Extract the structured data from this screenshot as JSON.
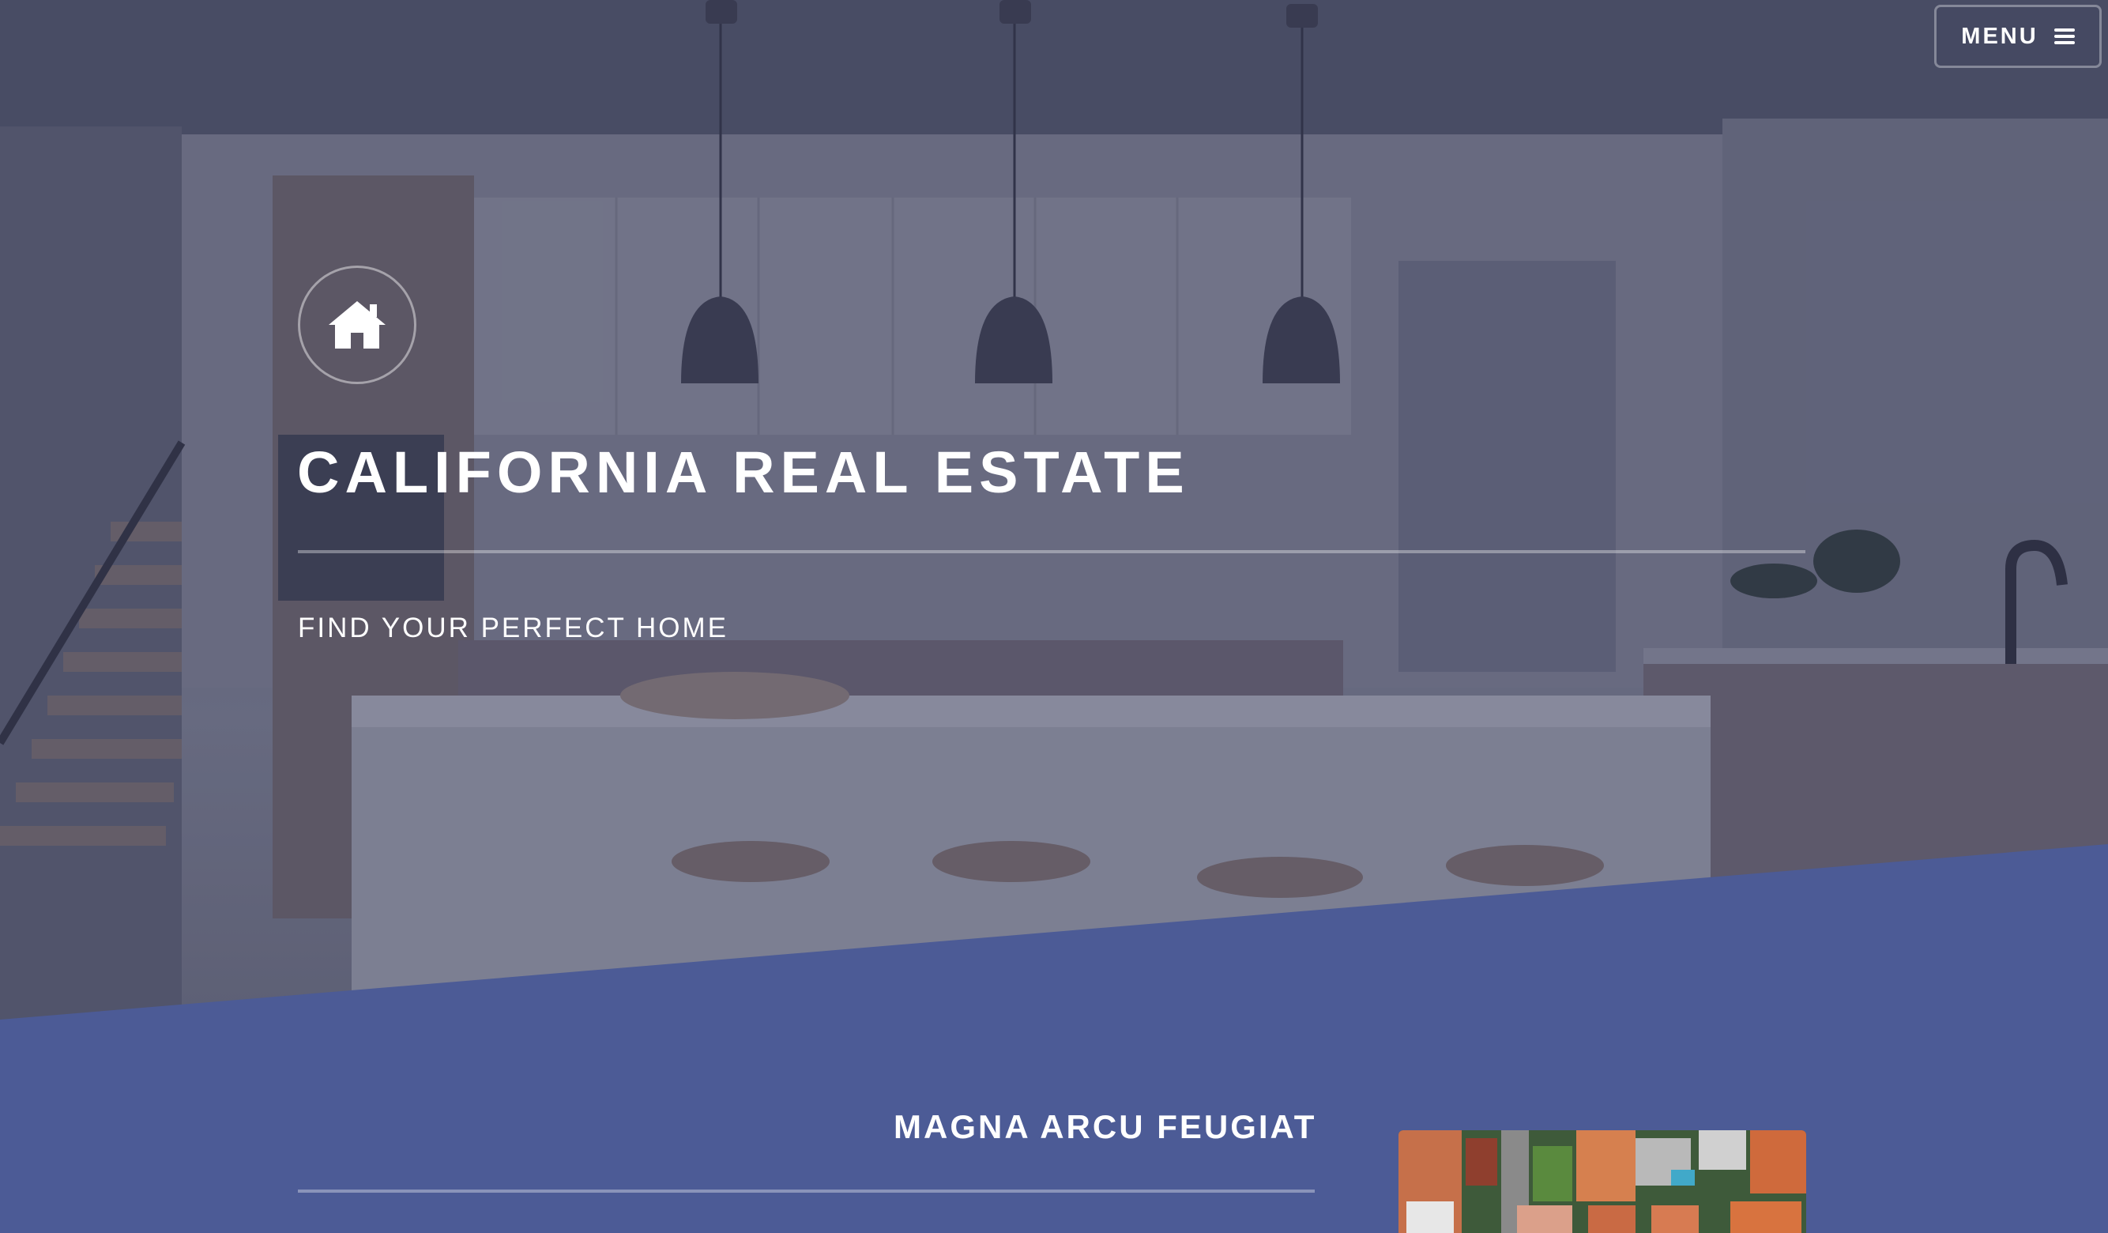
{
  "header": {
    "menu_label": "MENU",
    "menu_icon": "hamburger-icon"
  },
  "hero": {
    "logo_icon": "home-icon",
    "title": "CALIFORNIA REAL ESTATE",
    "subtitle": "FIND YOUR PERFECT HOME"
  },
  "section": {
    "title": "MAGNA ARCU FEUGIAT",
    "image": "aerial-houses-image"
  },
  "colors": {
    "accent": "#4c5b96",
    "text": "#ffffff"
  }
}
